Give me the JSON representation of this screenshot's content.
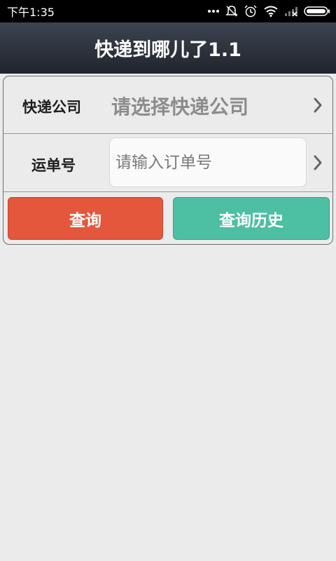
{
  "status_bar": {
    "time": "下午1:35",
    "icons": [
      "more-dots-icon",
      "notifications-off-icon",
      "alarm-icon",
      "wifi-icon",
      "signal-icon",
      "battery-icon"
    ]
  },
  "header": {
    "title": "快递到哪儿了1.1"
  },
  "form": {
    "company_label": "快递公司",
    "company_value": "请选择快递公司",
    "order_label": "运单号",
    "order_placeholder": "请输入订单号",
    "order_value": ""
  },
  "actions": {
    "query_label": "查询",
    "history_label": "查询历史"
  },
  "colors": {
    "query_button": "#e4573d",
    "history_button": "#4dbfa2",
    "title_bar": "#2b303a",
    "background": "#ebebeb"
  }
}
